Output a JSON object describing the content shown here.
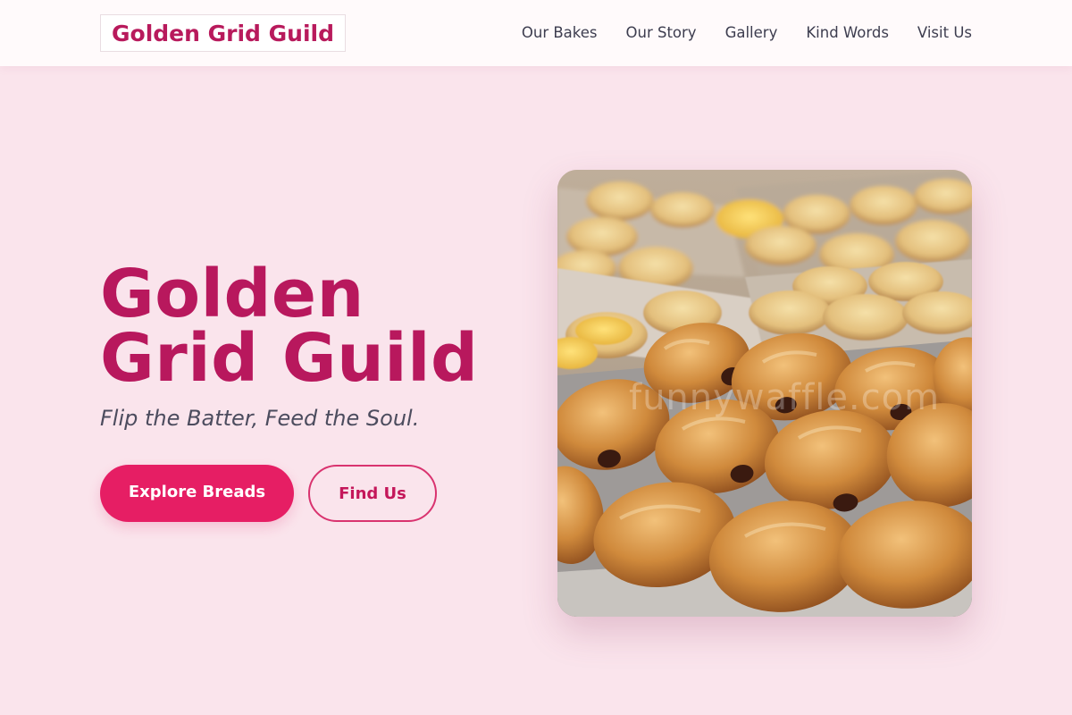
{
  "header": {
    "brand": "Golden Grid Guild",
    "nav": [
      {
        "label": "Our Bakes"
      },
      {
        "label": "Our Story"
      },
      {
        "label": "Gallery"
      },
      {
        "label": "Kind Words"
      },
      {
        "label": "Visit Us"
      }
    ]
  },
  "hero": {
    "title_line1": "Golden",
    "title_line2": "Grid Guild",
    "tagline": "Flip the Batter, Feed the Soul.",
    "primary_button": "Explore Breads",
    "secondary_button": "Find Us",
    "image_watermark": "funnywaffle.com"
  },
  "colors": {
    "page_background": "#fae4ec",
    "brand": "#b8185d",
    "primary_button": "#e61e64",
    "header_background": "#fffafb"
  }
}
